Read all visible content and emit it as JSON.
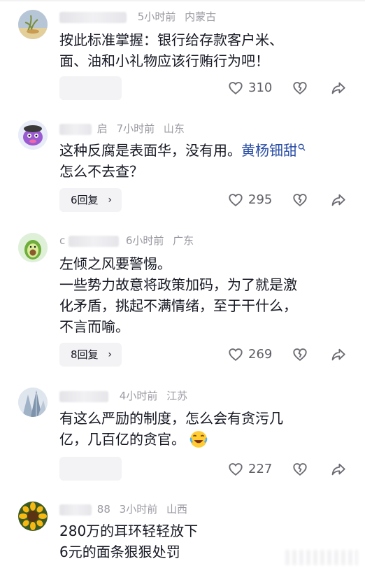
{
  "comments": [
    {
      "username": "",
      "time": "5小时前",
      "location": "内蒙古",
      "lines": [
        "按此标准掌握：银行给存款客户米、",
        "面、油和小礼物应该行贿行为吧！"
      ],
      "replies": "",
      "likes": "310"
    },
    {
      "username": "启",
      "time": "7小时前",
      "location": "山东",
      "lines": [
        "这种反腐是表面华，没有用。",
        "怎么不去查？"
      ],
      "tag": "黄杨钿甜",
      "replies": "6回复",
      "likes": "295"
    },
    {
      "username": "c",
      "time": "6小时前",
      "location": "广东",
      "lines": [
        "左倾之风要警惕。",
        "一些势力故意将政策加码，为了就是激",
        "化矛盾，挑起不满情绪，至于干什么，",
        "不言而喻。"
      ],
      "replies": "8回复",
      "likes": "269"
    },
    {
      "username": "",
      "time": "4小时前",
      "location": "江苏",
      "lines": [
        "有这么严励的制度，怎么会有贪污几",
        "亿，几百亿的贪官。"
      ],
      "replies": "",
      "likes": "227"
    },
    {
      "username": "88",
      "time": "3小时前",
      "location": "山西",
      "lines": [
        "280万的耳环轻轻放下",
        "6元的面条狠狠处罚"
      ]
    }
  ],
  "icons": {
    "like": "heart-outline-icon",
    "dislike": "broken-heart-icon",
    "share": "share-arrow-icon",
    "search": "search-icon",
    "laugh": "laughing-crying-emoji"
  },
  "colors": {
    "text": "#161823",
    "meta": "#9a9aa3",
    "tag": "#2a4ea6",
    "reply_bg": "#f3f3f5"
  }
}
